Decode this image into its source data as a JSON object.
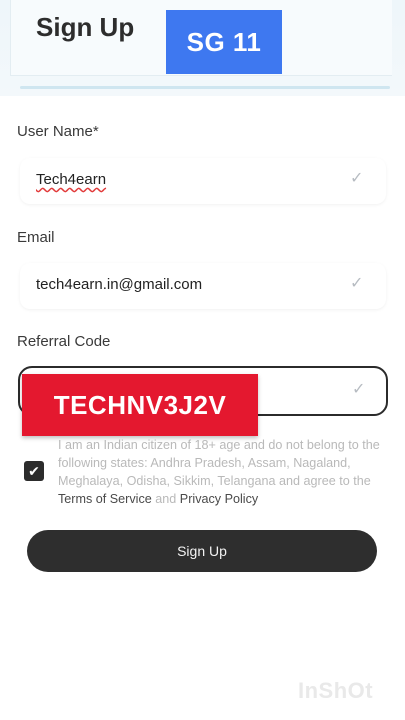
{
  "header": {
    "title": "Sign Up",
    "badge": "SG 11"
  },
  "form": {
    "username": {
      "label": "User Name*",
      "value": "Tech4earn"
    },
    "email": {
      "label": "Email",
      "value": "tech4earn.in@gmail.com"
    },
    "referral": {
      "label": "Referral Code",
      "value": "TECHNV3J2V"
    }
  },
  "consent": {
    "text": "I am an Indian citizen of 18+ age and do not belong to the following states: Andhra Pradesh, Assam, Nagaland, Meghalaya, Odisha, Sikkim, Telangana and agree to the",
    "terms": "Terms of Service",
    "and": "and",
    "privacy": "Privacy Policy",
    "checked": true
  },
  "actions": {
    "signup_label": "Sign Up"
  },
  "watermark": "InShOt",
  "colors": {
    "badge_blue": "#3e78f0",
    "referral_red": "#e4182f",
    "button_dark": "#2e2e2e"
  },
  "icons": {
    "field_check": "check-icon",
    "consent": "checkbox-checked-icon"
  }
}
